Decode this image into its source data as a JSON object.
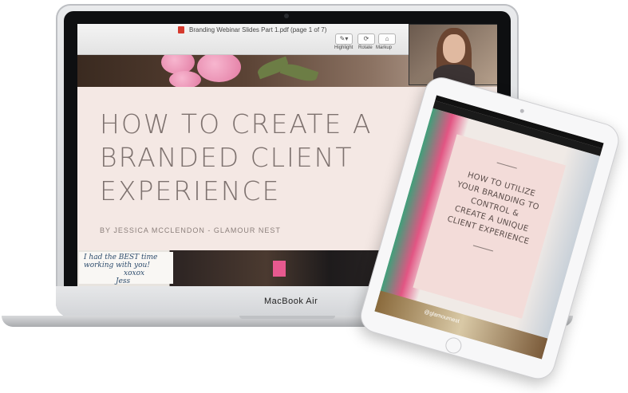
{
  "laptop": {
    "brand": "MacBook Air",
    "pdf": {
      "title": "Branding Webinar Slides Part 1.pdf (page 1 of 7)",
      "toolbar": [
        {
          "label": "Highlight",
          "icon": "pen-icon"
        },
        {
          "label": "Rotate",
          "icon": "rotate-icon"
        },
        {
          "label": "Markup",
          "icon": "toolbox-icon"
        }
      ]
    },
    "slide": {
      "headline_lines": [
        "HOW TO CREATE A",
        "BRANDED CLIENT",
        "EXPERIENCE"
      ],
      "byline": "BY JESSICA MCCLENDON - GLAMOUR NEST",
      "card_text": [
        "I had the BEST time",
        "working with you!",
        "xoxox",
        "Jess"
      ]
    }
  },
  "tablet": {
    "slide_lines": [
      "HOW TO UTILIZE",
      "YOUR BRANDING TO",
      "CONTROL &",
      "CREATE A UNIQUE",
      "CLIENT EXPERIENCE"
    ],
    "handle": "@glamournest"
  },
  "colors": {
    "band": "#f6e9e6",
    "headline": "#7d716e",
    "pdf_icon": "#d53a2e"
  }
}
